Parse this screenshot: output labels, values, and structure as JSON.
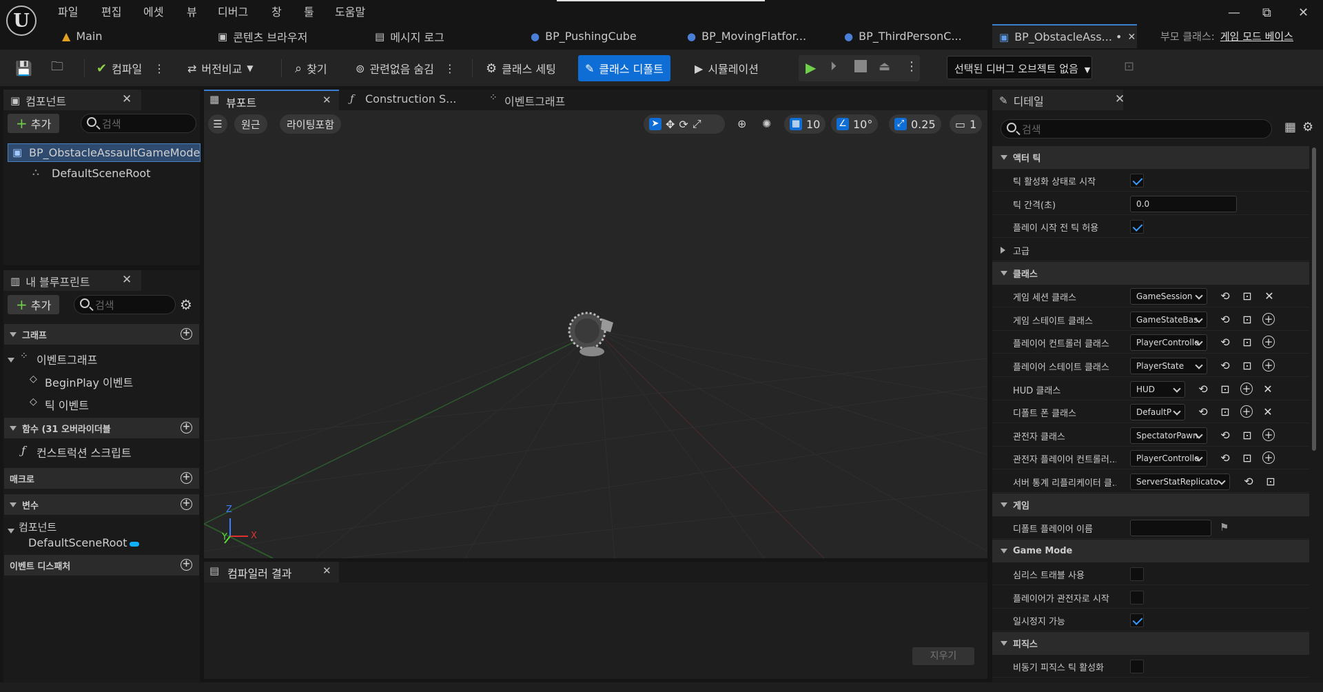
{
  "menu": {
    "items": [
      "파일",
      "편집",
      "에셋",
      "뷰",
      "디버그",
      "창",
      "툴",
      "도움말"
    ],
    "logo": "U",
    "minimize": "—",
    "maximize": "⧉",
    "close": "✕"
  },
  "tabs": {
    "main": "Main",
    "content_browser": "콘텐츠 브라우저",
    "message_log": "메시지 로그",
    "pushing_cube": "BP_PushingCube",
    "moving_platform": "BP_MovingFlatfor...",
    "third_person": "BP_ThirdPersonC...",
    "obstacle": "BP_ObstacleAss... •",
    "obstacle_close": "✕",
    "parent_class_label": "부모 클래스:",
    "parent_class_value": "게임 모드 베이스"
  },
  "toolbar": {
    "compile": "컴파일",
    "diff": "버전비교",
    "find": "찾기",
    "hide_unrelated": "관련없음 숨김",
    "class_settings": "클래스 세팅",
    "class_defaults": "클래스 디폴트",
    "simulation": "시뮬레이션",
    "debug_object": "선택된 디버그 오브젝트 없음"
  },
  "components_panel": {
    "title": "컴포넌트",
    "add": "추가",
    "search_placeholder": "검색",
    "root_item": "BP_ObstacleAssaultGameMode",
    "child_item": "DefaultSceneRoot"
  },
  "my_blueprint": {
    "title": "내 블루프린트",
    "add": "추가",
    "search_placeholder": "검색",
    "graph_section": "그래프",
    "event_graph": "이벤트그래프",
    "begin_play": "BeginPlay 이벤트",
    "tick_event": "틱 이벤트",
    "functions_section": "함수 (31 오버라이더블",
    "construction_script": "컨스트럭션 스크립트",
    "macros_section": "매크로",
    "variables_section": "변수",
    "components_group": "컴포넌트",
    "default_scene_root": "DefaultSceneRoot",
    "event_dispatchers": "이벤트 디스패처"
  },
  "editor_tabs": {
    "viewport": "뷰포트",
    "construction": "Construction S...",
    "event_graph": "이벤트그래프"
  },
  "viewport": {
    "perspective": "원근",
    "lighting": "라이팅포함",
    "grid_snap": "10",
    "rotation_snap": "10°",
    "scale_snap": "0.25",
    "camera_speed": "1",
    "axis_x": "X",
    "axis_y": "Y",
    "axis_z": "Z"
  },
  "compiler_results": {
    "title": "컴파일러 결과",
    "clear": "지우기"
  },
  "details": {
    "title": "디테일",
    "search_placeholder": "검색",
    "sections": {
      "actor_tick": "액터 틱",
      "advanced": "고급",
      "classes": "클래스",
      "game": "게임",
      "game_mode": "Game Mode",
      "physics": "피직스"
    },
    "rows": {
      "tick_enabled": "틱 활성화 상태로 시작",
      "tick_interval": "틱 간격(초)",
      "tick_interval_value": "0.0",
      "tick_before_play": "플레이 시작 전 틱 허용",
      "game_session": "게임 세션 클래스",
      "game_session_value": "GameSession",
      "game_state": "게임 스테이트 클래스",
      "game_state_value": "GameStateBas",
      "player_controller": "플레이어 컨트롤러 클래스",
      "player_controller_value": "PlayerControlle",
      "player_state": "플레이어 스테이트 클래스",
      "player_state_value": "PlayerState",
      "hud": "HUD 클래스",
      "hud_value": "HUD",
      "default_pawn": "디폴트 폰 클래스",
      "default_pawn_value": "DefaultP",
      "spectator": "관전자 클래스",
      "spectator_value": "SpectatorPawn",
      "spectator_controller": "관전자 플레이어 컨트롤러...",
      "spectator_controller_value": "PlayerControlle",
      "server_stat": "서버 통계 리플리케이터 클...",
      "server_stat_value": "ServerStatReplicato",
      "default_player_name": "디폴트 플레이어 이름",
      "seamless_travel": "심리스 트래블 사용",
      "start_as_spectator": "플레이어가 관전자로 시작",
      "pausable": "일시정지 가능",
      "async_physics": "비동기 피직스 틱 활성화"
    }
  }
}
